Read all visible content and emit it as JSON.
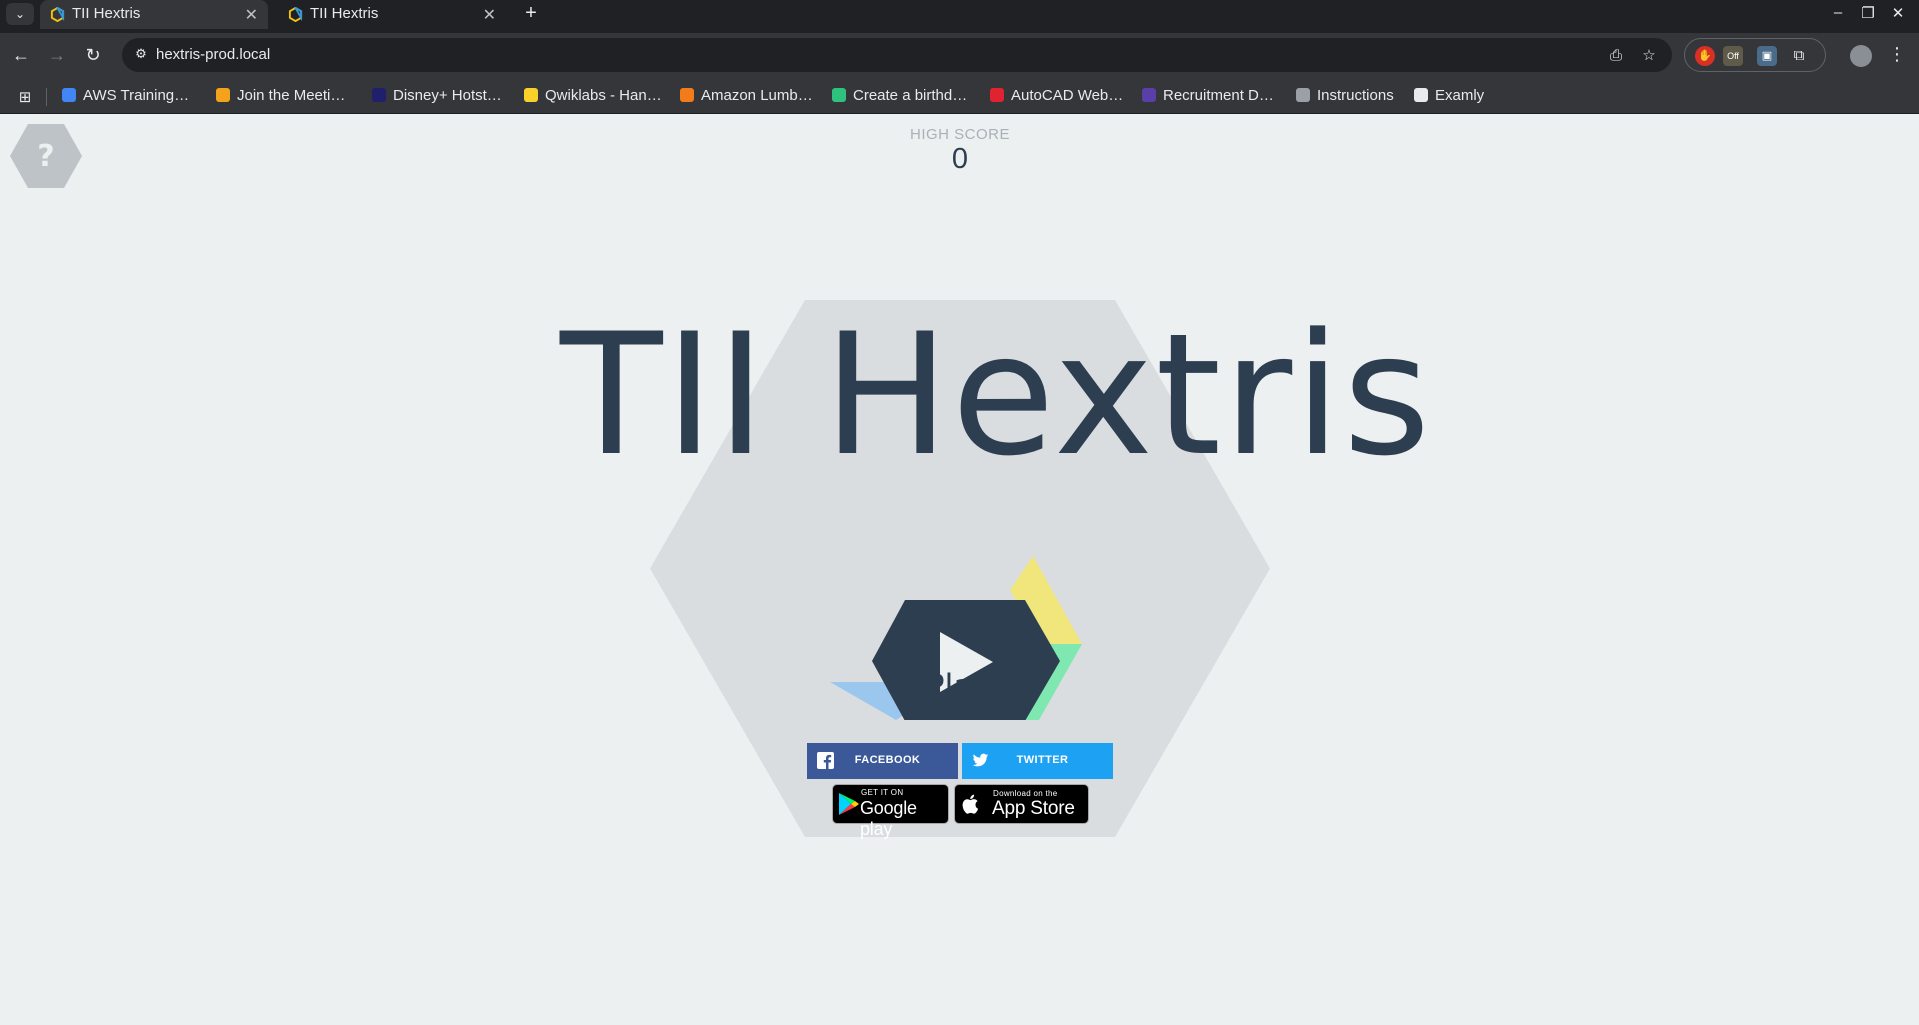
{
  "browser": {
    "tabs": [
      {
        "title": "TII Hextris",
        "active": true
      },
      {
        "title": "TII Hextris",
        "active": false
      }
    ],
    "url": "hextris-prod.local",
    "bookmarks": [
      {
        "label": "AWS Training…",
        "icon": "aws-icon",
        "color": "#4285f4"
      },
      {
        "label": "Join the Meeti…",
        "icon": "meeting-icon",
        "color": "#f4a21b"
      },
      {
        "label": "Disney+ Hotst…",
        "icon": "hotstar-icon",
        "color": "#1f1f6b"
      },
      {
        "label": "Qwiklabs - Han…",
        "icon": "qwiklabs-icon",
        "color": "#f8d12b"
      },
      {
        "label": "Amazon Lumb…",
        "icon": "lumberyard-icon",
        "color": "#f27c1c"
      },
      {
        "label": "Create a birthd…",
        "icon": "birthday-icon",
        "color": "#2ec27e"
      },
      {
        "label": "AutoCAD Web…",
        "icon": "autocad-icon",
        "color": "#e02330"
      },
      {
        "label": "Recruitment D…",
        "icon": "recruitment-icon",
        "color": "#5b3fa8"
      },
      {
        "label": "Instructions",
        "icon": "globe-icon",
        "color": "#9aa0a6"
      },
      {
        "label": "Examly",
        "icon": "examly-icon",
        "color": "#e8eaed"
      }
    ]
  },
  "game": {
    "help_symbol": "?",
    "high_score_label": "HIGH SCORE",
    "high_score_value": "0",
    "title": "TII Hextris",
    "play_label": "Play!",
    "colors": {
      "text": "#2c3e50",
      "yellow": "#f1e67b",
      "green": "#7ee8b0",
      "blue": "#9bc7ee",
      "red": "#f39b9b",
      "hex_bg": "#d9dde0"
    }
  },
  "social": {
    "facebook_label": "FACEBOOK",
    "twitter_label": "TWITTER",
    "facebook_color": "#3b5998",
    "twitter_color": "#1da1f2"
  },
  "stores": {
    "google_small": "GET IT ON",
    "google_big": "Google play",
    "apple_small": "Download on the",
    "apple_big": "App Store"
  }
}
